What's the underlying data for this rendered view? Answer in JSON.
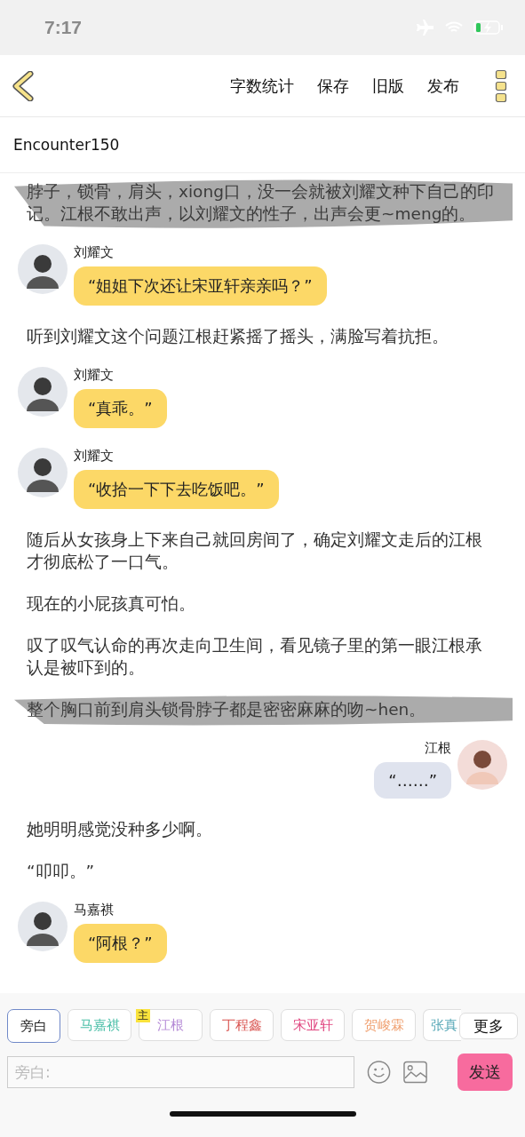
{
  "status_bar": {
    "time": "7:17"
  },
  "toolbar": {
    "actions": [
      "字数统计",
      "保存",
      "旧版",
      "发布"
    ]
  },
  "title": "Encounter150",
  "story": [
    {
      "kind": "narration",
      "text": "脖子，锁骨，肩头，xiong口，没一会就被刘耀文种下自己的印记。江根不敢出声，以刘耀文的性子，出声会更~meng的。",
      "scribbled": true
    },
    {
      "kind": "incoming",
      "speaker": "刘耀文",
      "text": "“姐姐下次还让宋亚轩亲亲吗？”"
    },
    {
      "kind": "narration",
      "text": "听到刘耀文这个问题江根赶紧摇了摇头，满脸写着抗拒。",
      "scribbled": false
    },
    {
      "kind": "incoming",
      "speaker": "刘耀文",
      "text": "“真乖。”"
    },
    {
      "kind": "incoming",
      "speaker": "刘耀文",
      "text": "“收拾一下下去吃饭吧。”"
    },
    {
      "kind": "narration",
      "text": "随后从女孩身上下来自己就回房间了，确定刘耀文走后的江根才彻底松了一口气。",
      "scribbled": false
    },
    {
      "kind": "narration",
      "text": "现在的小屁孩真可怕。",
      "scribbled": false
    },
    {
      "kind": "narration",
      "text": "叹了叹气认命的再次走向卫生间，看见镜子里的第一眼江根承认是被吓到的。",
      "scribbled": false
    },
    {
      "kind": "narration",
      "text": "整个胸口前到肩头锁骨脖子都是密密麻麻的吻~hen。",
      "scribbled": true
    },
    {
      "kind": "outgoing",
      "speaker": "江根",
      "text": "“……”"
    },
    {
      "kind": "narration",
      "text": "她明明感觉没种多少啊。",
      "scribbled": false
    },
    {
      "kind": "narration",
      "text": "“叩叩。”",
      "scribbled": false
    },
    {
      "kind": "incoming",
      "speaker": "马嘉祺",
      "text": "“阿根？”"
    }
  ],
  "characters": [
    {
      "label": "旁白",
      "color": "#222222",
      "selected": true
    },
    {
      "label": "马嘉祺",
      "color": "#4bbfa8",
      "selected": false
    },
    {
      "label": "江根",
      "color": "#b58ad6",
      "selected": false,
      "badge": "主"
    },
    {
      "label": "丁程鑫",
      "color": "#d9534f",
      "selected": false
    },
    {
      "label": "宋亚轩",
      "color": "#e0457f",
      "selected": false
    },
    {
      "label": "贺峻霖",
      "color": "#f0a070",
      "selected": false
    },
    {
      "label": "张真",
      "color": "#5aa9b8",
      "selected": false
    }
  ],
  "more_button": "更多",
  "input": {
    "placeholder": "旁白:"
  },
  "send_button": "发送"
}
